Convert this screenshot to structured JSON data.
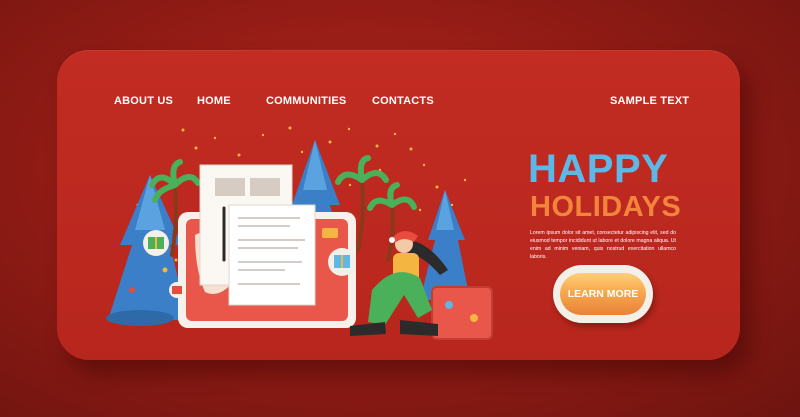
{
  "nav": {
    "items": [
      "ABOUT US",
      "HOME",
      "COMMUNITIES",
      "CONTACTS"
    ],
    "right_text": "SAMPLE TEXT"
  },
  "hero": {
    "title_line1": "HAPPY",
    "title_line2": "HOLIDAYS",
    "body": "Lorem ipsum dolor sit amet, consectetur adipiscing elit, sed do eiusmod tempor incididunt ut labore et dolore magna aliqua. Ut enim ad minim veniam, quis nostrud exercitation ullamco laboris.",
    "button_label": "LEARN MORE"
  },
  "colors": {
    "background": "#8d1a14",
    "card": "#c22c22",
    "title_blue": "#5db8e8",
    "title_orange": "#f2843c",
    "button": "#f6a84c"
  },
  "illustration": {
    "icons": [
      "christmas-tree-icon",
      "palm-tree-icon",
      "tablet-map-icon",
      "document-icon",
      "gift-icon",
      "suitcase-icon",
      "santa-woman-icon"
    ]
  }
}
